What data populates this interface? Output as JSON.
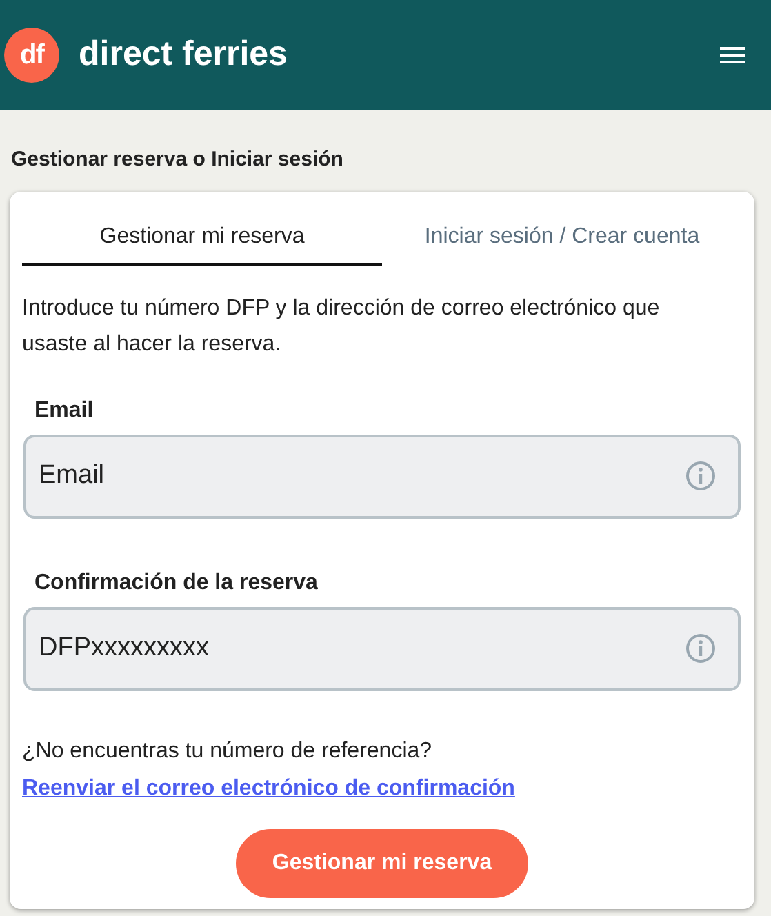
{
  "header": {
    "logo_mark": "df",
    "brand": "direct ferries"
  },
  "page_title": "Gestionar reserva o Iniciar sesión",
  "tabs": [
    {
      "label": "Gestionar mi reserva",
      "selected": true
    },
    {
      "label": "Iniciar sesión / Crear cuenta",
      "selected": false
    }
  ],
  "intro": "Introduce tu número DFP y la dirección de correo electrónico que usaste al hacer la reserva.",
  "fields": [
    {
      "label": "Email",
      "placeholder": "Email"
    },
    {
      "label": "Confirmación de la reserva",
      "placeholder": "DFPxxxxxxxxx"
    }
  ],
  "help": {
    "text": "¿No encuentras tu número de referencia?",
    "link": "Reenviar el correo electrónico de confirmación"
  },
  "submit_button": "Gestionar mi reserva"
}
